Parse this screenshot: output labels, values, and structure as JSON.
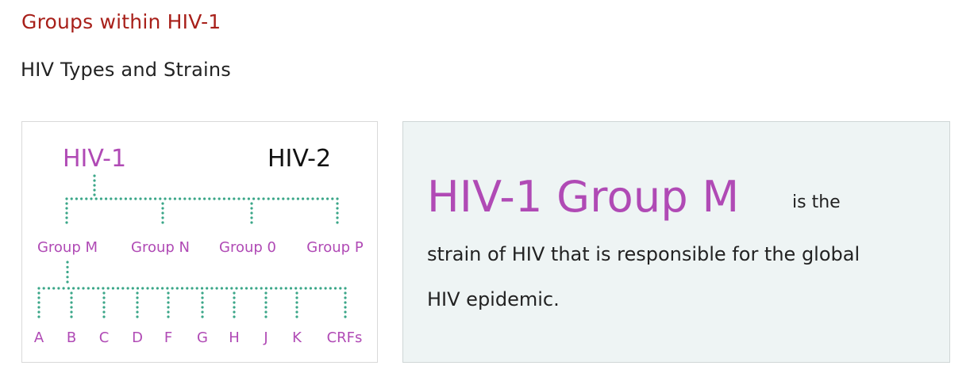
{
  "colors": {
    "heading": "#a8201a",
    "text": "#222222",
    "accent": "#b04ab5",
    "dots": "#3aa688",
    "panel_bg": "#eef4f4"
  },
  "section_heading": "Groups within HIV-1",
  "subheading": "HIV Types and Strains",
  "diagram": {
    "types": [
      "HIV-1",
      "HIV-2"
    ],
    "groups": [
      "Group M",
      "Group N",
      "Group 0",
      "Group P"
    ],
    "subtypes": [
      "A",
      "B",
      "C",
      "D",
      "F",
      "G",
      "H",
      "J",
      "K",
      "CRFs"
    ]
  },
  "info": {
    "big_title": "HIV-1 Group M",
    "inline_text": "is the",
    "line1": "strain of HIV that is responsible for the global",
    "line2": "HIV epidemic."
  }
}
